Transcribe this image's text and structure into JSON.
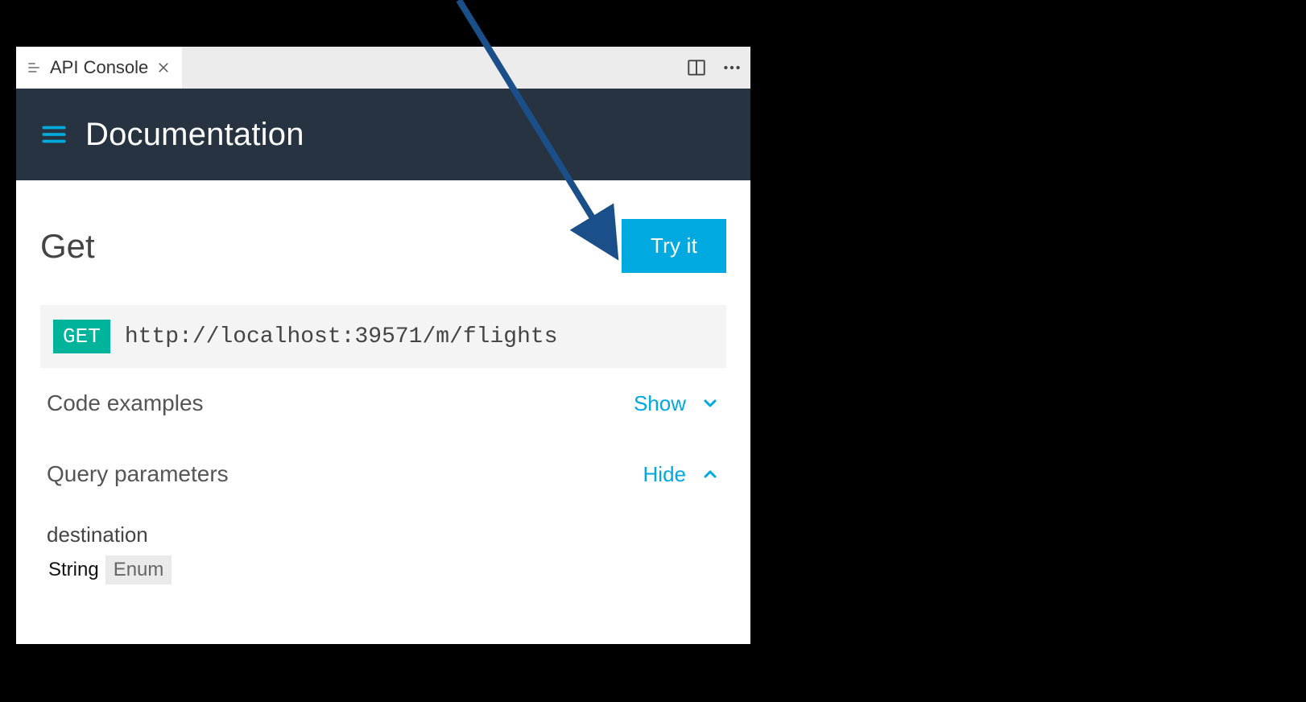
{
  "tab": {
    "title": "API Console"
  },
  "header": {
    "title": "Documentation"
  },
  "endpoint": {
    "title": "Get",
    "try_label": "Try it",
    "method": "GET",
    "url": "http://localhost:39571/m/flights"
  },
  "sections": {
    "code_examples": {
      "label": "Code examples",
      "toggle": "Show"
    },
    "query_params": {
      "label": "Query parameters",
      "toggle": "Hide"
    }
  },
  "param": {
    "name": "destination",
    "type_primary": "String",
    "type_secondary": "Enum"
  },
  "colors": {
    "accent": "#00a9e0",
    "method_badge": "#00b39b",
    "header_bg": "#273340",
    "arrow": "#1a4f8a"
  }
}
